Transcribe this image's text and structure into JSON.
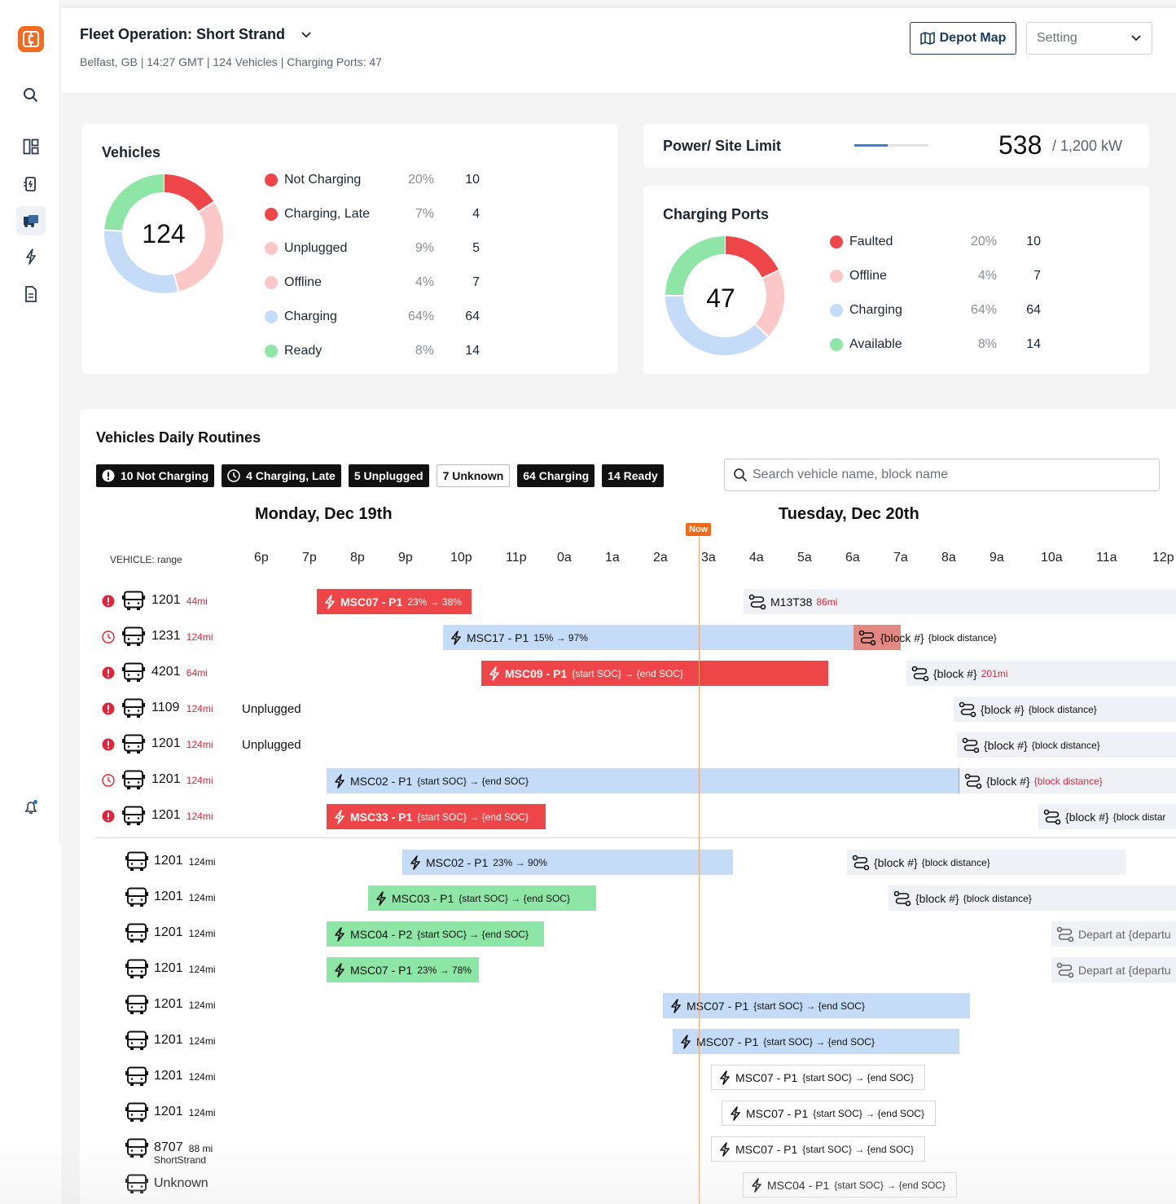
{
  "colors": {
    "accent": "#f26b21",
    "navy": "#1c3b63",
    "red": "#ee4548",
    "pink": "#fbc7c7",
    "blue": "#c4dcf7",
    "green": "#8ee6a6",
    "now": "#f06a1c"
  },
  "sidebar": {
    "items": [
      {
        "icon": "search-icon"
      },
      {
        "icon": "dashboard-icon"
      },
      {
        "icon": "charger-icon"
      },
      {
        "icon": "bus-icon",
        "active": true
      },
      {
        "icon": "bolt-icon"
      },
      {
        "icon": "document-icon"
      },
      {
        "icon": "bell-icon"
      }
    ]
  },
  "header": {
    "title": "Fleet Operation: Short Strand",
    "subtitle": "Belfast, GB | 14:27 GMT | 124 Vehicles | Charging Ports: 47",
    "depot_map": "Depot Map",
    "setting": "Setting"
  },
  "vehicles": {
    "title": "Vehicles",
    "total": "124",
    "legend": [
      {
        "label": "Not Charging",
        "pct": "20%",
        "count": "10",
        "color": "#ee4548"
      },
      {
        "label": "Charging, Late",
        "pct": "7%",
        "count": "4",
        "color": "#ee4548"
      },
      {
        "label": "Unplugged",
        "pct": "9%",
        "count": "5",
        "color": "#fbc7c7"
      },
      {
        "label": "Offline",
        "pct": "4%",
        "count": "7",
        "color": "#fbc7c7"
      },
      {
        "label": "Charging",
        "pct": "64%",
        "count": "64",
        "color": "#c4dcf7"
      },
      {
        "label": "Ready",
        "pct": "8%",
        "count": "14",
        "color": "#8ee6a6"
      }
    ],
    "donut": [
      {
        "value": 0.16,
        "color": "#ee4548"
      },
      {
        "value": 0.3,
        "color": "#fbc7c7"
      },
      {
        "value": 0.3,
        "color": "#c4dcf7"
      },
      {
        "value": 0.24,
        "color": "#8ee6a6"
      }
    ]
  },
  "power": {
    "title": "Power/ Site Limit",
    "value": "538",
    "limit": "/ 1,200 kW",
    "fraction": 0.45
  },
  "ports": {
    "title": "Charging Ports",
    "total": "47",
    "legend": [
      {
        "label": "Faulted",
        "pct": "20%",
        "count": "10",
        "color": "#ee4548"
      },
      {
        "label": "Offline",
        "pct": "4%",
        "count": "7",
        "color": "#fbc7c7"
      },
      {
        "label": "Charging",
        "pct": "64%",
        "count": "64",
        "color": "#c4dcf7"
      },
      {
        "label": "Available",
        "pct": "8%",
        "count": "14",
        "color": "#8ee6a6"
      }
    ],
    "donut": [
      {
        "value": 0.18,
        "color": "#ee4548"
      },
      {
        "value": 0.19,
        "color": "#fbc7c7"
      },
      {
        "value": 0.38,
        "color": "#c4dcf7"
      },
      {
        "value": 0.25,
        "color": "#8ee6a6"
      }
    ]
  },
  "routines": {
    "title": "Vehicles Daily Routines",
    "filters": [
      {
        "label": "10 Not Charging",
        "icon": "alert-icon"
      },
      {
        "label": "4 Charging, Late",
        "icon": "clock-icon"
      },
      {
        "label": "5 Unplugged"
      },
      {
        "label": "7 Unknown",
        "light": true
      },
      {
        "label": "64 Charging"
      },
      {
        "label": "14 Ready"
      }
    ],
    "search_placeholder": "Search vehicle name, block name",
    "day1": "Monday, Dec 19th",
    "day2": "Tuesday, Dec 20th",
    "now": "Now",
    "vehicle_header": "VEHICLE: range",
    "hours": [
      "6p",
      "7p",
      "8p",
      "9p",
      "10p",
      "11p",
      "0a",
      "1a",
      "2a",
      "3a",
      "4a",
      "5a",
      "6a",
      "7a",
      "8a",
      "9a",
      "10a",
      "11a",
      "12p"
    ]
  },
  "rows": [
    {
      "status": "alert",
      "name": "1201",
      "range": "44mi",
      "bar": {
        "t": "red",
        "a": "MSC07 - P1",
        "b": "23% → 38%"
      },
      "blk": {
        "a": "M13T38",
        "b": "86mi",
        "bred": true
      }
    },
    {
      "status": "clock",
      "name": "1231",
      "range": "124mi",
      "bar": {
        "t": "blue",
        "a": "MSC17 - P1",
        "b": "15% → 97%"
      },
      "blk": {
        "a": "{block #}",
        "b": "{block distance}"
      }
    },
    {
      "status": "alert",
      "name": "4201",
      "range": "64mi",
      "bar": {
        "t": "red",
        "a": "MSC09 - P1",
        "b": "{start SOC} → {end SOC}"
      },
      "blk": {
        "a": "{block #}",
        "b": "201mi",
        "bred": true
      }
    },
    {
      "status": "alert",
      "name": "1109",
      "range": "124mi",
      "unplugged": "Unplugged",
      "blk": {
        "a": "{block #}",
        "b": "{block distance}"
      }
    },
    {
      "status": "alert",
      "name": "1201",
      "range": "124mi",
      "unplugged": "Unplugged",
      "blk": {
        "a": "{block #}",
        "b": "{block distance}"
      }
    },
    {
      "status": "clock",
      "name": "1201",
      "range": "124mi",
      "bar": {
        "t": "blue",
        "a": "MSC02 - P1",
        "b": "{start SOC} → {end SOC}"
      },
      "blk": {
        "a": "{block #}",
        "b": "{block distance}",
        "bred": true
      }
    },
    {
      "status": "alert",
      "name": "1201",
      "range": "124mi",
      "bar": {
        "t": "red",
        "a": "MSC33 - P1",
        "b": "{start SOC} → {end SOC}"
      },
      "blk": {
        "a": "{block #}",
        "b": "{block distar"
      }
    },
    {
      "name": "1201",
      "range": "124mi",
      "bar": {
        "t": "blue",
        "a": "MSC02 - P1",
        "b": "23% → 90%"
      },
      "blk": {
        "a": "{block #}",
        "b": "{block distance}"
      }
    },
    {
      "name": "1201",
      "range": "124mi",
      "bar": {
        "t": "green",
        "a": "MSC03 - P1",
        "b": "{start SOC} → {end SOC}"
      },
      "blk": {
        "a": "{block #}",
        "b": "{block distance}"
      }
    },
    {
      "name": "1201",
      "range": "124mi",
      "bar": {
        "t": "green",
        "a": "MSC04 - P2",
        "b": "{start SOC} → {end SOC}"
      },
      "blk": {
        "a": "Depart at {departu",
        "b": "",
        "gray": true
      }
    },
    {
      "name": "1201",
      "range": "124mi",
      "bar": {
        "t": "green",
        "a": "MSC07 - P1",
        "b": "23% → 78%"
      },
      "blk": {
        "a": "Depart at {departu",
        "b": "",
        "gray": true
      }
    },
    {
      "name": "1201",
      "range": "124mi",
      "bar": {
        "t": "blue",
        "a": "MSC07 - P1",
        "b": "{start SOC} → {end SOC}"
      }
    },
    {
      "name": "1201",
      "range": "124mi",
      "bar": {
        "t": "blue",
        "a": "MSC07 - P1",
        "b": "{start SOC} → {end SOC}"
      }
    },
    {
      "name": "1201",
      "range": "124mi",
      "bar": {
        "t": "outline",
        "a": "MSC07 - P1",
        "b": "{start SOC} → {end SOC}"
      }
    },
    {
      "name": "1201",
      "range": "124mi",
      "bar": {
        "t": "outline",
        "a": "MSC07 - P1",
        "b": "{start SOC} → {end SOC}"
      }
    },
    {
      "name": "8707",
      "range": "88 mi",
      "sub": "ShortStrand",
      "bar": {
        "t": "outline",
        "a": "MSC07 - P1",
        "b": "{start SOC} → {end SOC}"
      }
    },
    {
      "name": "Unknown",
      "range": "",
      "bar": {
        "t": "outline",
        "a": "MSC04 - P1",
        "b": "{start SOC} → {end SOC}"
      }
    }
  ]
}
